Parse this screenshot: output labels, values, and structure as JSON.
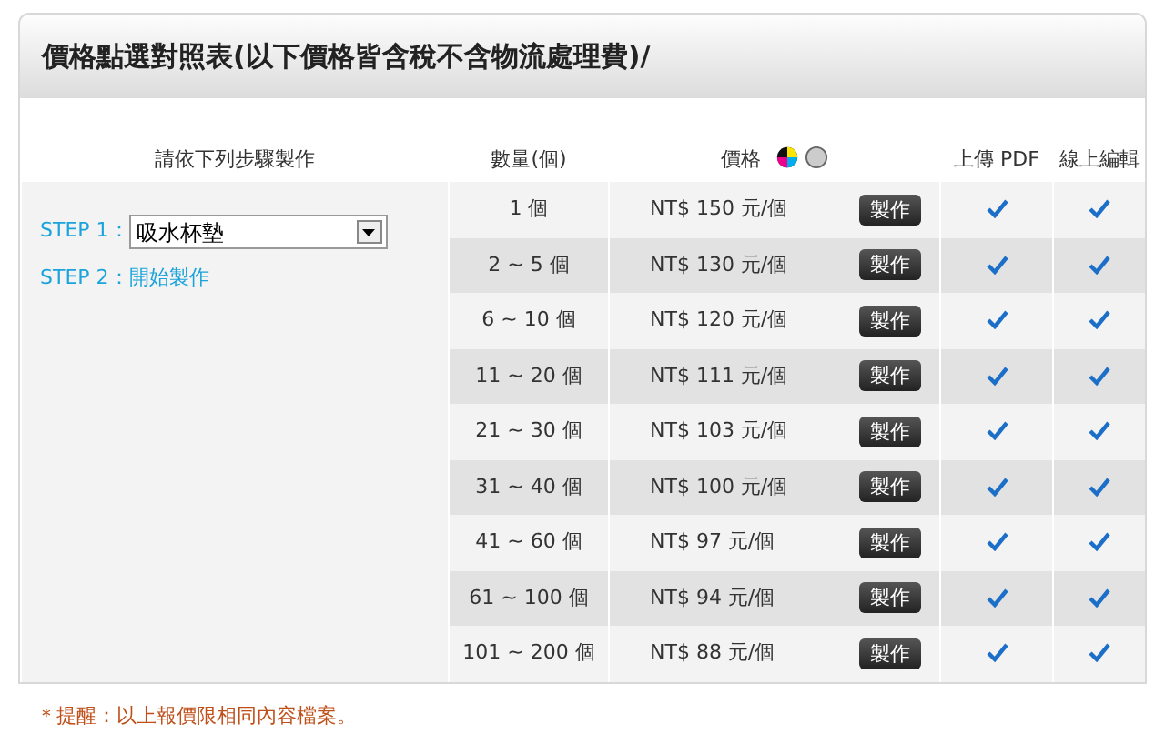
{
  "panel": {
    "title": "價格點選對照表(以下價格皆含稅不含物流處理費)/"
  },
  "columns": [
    "請依下列步驟製作",
    "數量(個)",
    "價格",
    "上傳 PDF",
    "線上編輯"
  ],
  "steps": {
    "step1_label": "STEP 1：",
    "product": "吸水杯墊",
    "step2_label": "STEP 2：",
    "step2_link": "開始製作"
  },
  "rows": [
    {
      "quantity": "1 個",
      "price": "NT$ 150 元/個",
      "button": "製作",
      "pdf": true,
      "online_edit": true
    },
    {
      "quantity": "2 ~ 5 個",
      "price": "NT$ 130 元/個",
      "button": "製作",
      "pdf": true,
      "online_edit": true
    },
    {
      "quantity": "6 ~ 10 個",
      "price": "NT$ 120 元/個",
      "button": "製作",
      "pdf": true,
      "online_edit": true
    },
    {
      "quantity": "11 ~ 20 個",
      "price": "NT$ 111 元/個",
      "button": "製作",
      "pdf": true,
      "online_edit": true
    },
    {
      "quantity": "21 ~ 30 個",
      "price": "NT$ 103 元/個",
      "button": "製作",
      "pdf": true,
      "online_edit": true
    },
    {
      "quantity": "31 ~ 40 個",
      "price": "NT$ 100 元/個",
      "button": "製作",
      "pdf": true,
      "online_edit": true
    },
    {
      "quantity": "41 ~ 60 個",
      "price": "NT$ 97 元/個",
      "button": "製作",
      "pdf": true,
      "online_edit": true
    },
    {
      "quantity": "61 ~ 100 個",
      "price": "NT$ 94 元/個",
      "button": "製作",
      "pdf": true,
      "online_edit": true
    },
    {
      "quantity": "101 ~ 200 個",
      "price": "NT$ 88 元/個",
      "button": "製作",
      "pdf": true,
      "online_edit": true
    }
  ],
  "note": "＊提醒：以上報價限相同內容檔案。"
}
